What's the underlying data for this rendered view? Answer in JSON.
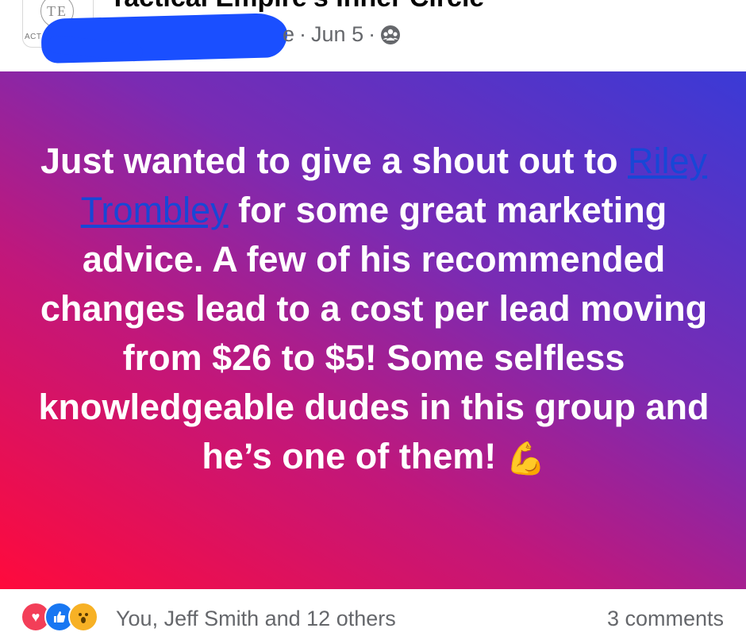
{
  "header": {
    "group_title": "Tactical Empire's Inner Circle",
    "avatar_monogram": "TE",
    "avatar_tag": "ACT",
    "author_tail": "e",
    "separator": "·",
    "date": "Jun 5",
    "privacy_icon": "group-members-icon"
  },
  "post": {
    "text_before": "Just wanted to give a shout out to ",
    "mention": "Riley Trombley",
    "text_after": " for some great marketing advice. A few of his recommended changes lead to a cost per lead moving from $26 to $5! Some selfless knowledgeable dudes in this group and he’s one of them! ",
    "emoji": "💪",
    "gradient_colors": [
      "#ff0a3c",
      "#c2177a",
      "#7a2bb3",
      "#3a3ad6"
    ]
  },
  "footer": {
    "reactions": [
      "love",
      "like",
      "wow"
    ],
    "reaction_names": "You, Jeff Smith and 12 others",
    "comments": "3 comments"
  }
}
